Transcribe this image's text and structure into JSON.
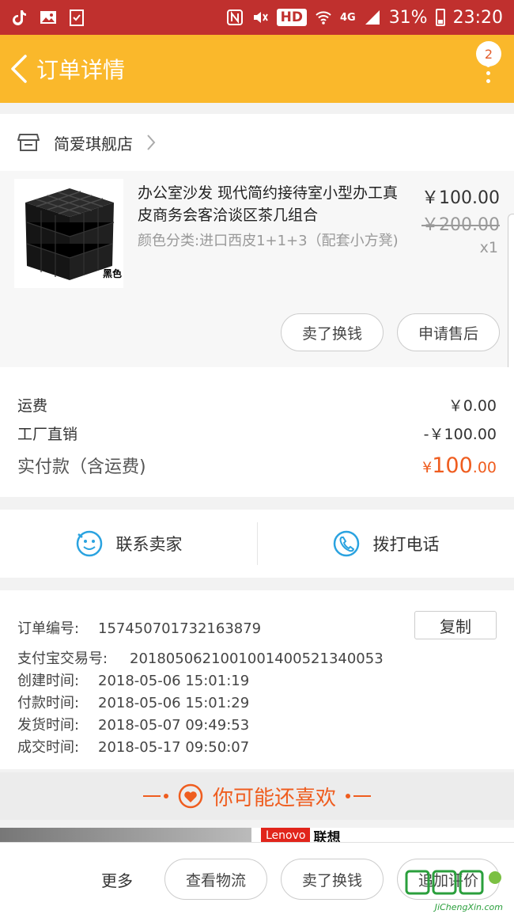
{
  "status_bar": {
    "signal_type": "4G",
    "battery": "31%",
    "time": "23:20",
    "hd": "HD"
  },
  "header": {
    "title": "订单详情",
    "badge_count": "2",
    "bg_color": "#fab82b"
  },
  "shop": {
    "name": "简爱琪舰店"
  },
  "product": {
    "name": "办公室沙发 现代简约接待室小型办工真皮商务会客洽谈区茶几组合",
    "sku": "颜色分类:进口西皮1+1+3（配套小方凳)",
    "price": "￥100.00",
    "original_price": "￥200.00",
    "quantity": "x1",
    "image_label": "黑色",
    "buttons": [
      "卖了换钱",
      "申请售后"
    ]
  },
  "fees": {
    "shipping_label": "运费",
    "shipping_value": "￥0.00",
    "discount_label": "工厂直销",
    "discount_value": "-￥100.00",
    "paid_label": "实付款（含运费)",
    "paid_symbol": "¥",
    "paid_integer": "100",
    "paid_decimal": ".00",
    "accent_color": "#ef5d1f"
  },
  "contact": {
    "seller": "联系卖家",
    "phone": "拨打电话"
  },
  "order": {
    "copy_label": "复制",
    "rows": [
      {
        "label": "订单编号:",
        "value": "157450701732163879"
      },
      {
        "label": "支付宝交易号:",
        "value": "2018050621001001400521340053"
      },
      {
        "label": "创建时间:",
        "value": "2018-05-06 15:01:19"
      },
      {
        "label": "付款时间:",
        "value": "2018-05-06 15:01:29"
      },
      {
        "label": "发货时间:",
        "value": "2018-05-07 09:49:53"
      },
      {
        "label": "成交时间:",
        "value": "2018-05-17 09:50:07"
      }
    ]
  },
  "recommend": {
    "title": "你可能还喜欢"
  },
  "banner": {
    "brand_logo": "Lenovo",
    "brand_cn": "联想"
  },
  "bottom_bar": {
    "more": "更多",
    "buttons": [
      "查看物流",
      "卖了换钱",
      "追加评价"
    ]
  },
  "watermark": {
    "text": "JiChengXin.com"
  }
}
